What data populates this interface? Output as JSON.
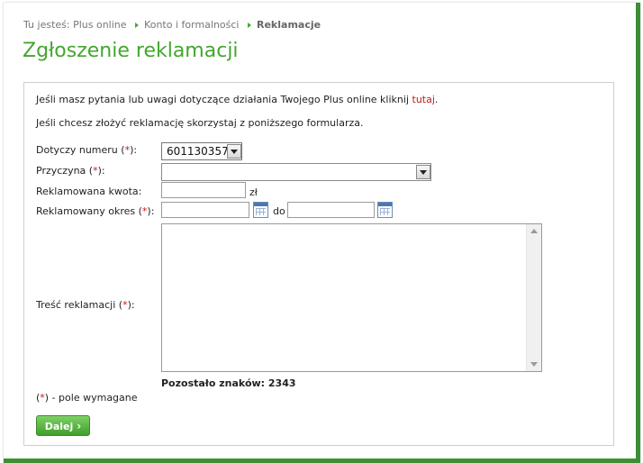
{
  "breadcrumb": {
    "prefix": "Tu jesteś:",
    "items": [
      "Plus online",
      "Konto i formalności",
      "Reklamacje"
    ]
  },
  "page_title": "Zgłoszenie reklamacji",
  "info": {
    "line1_text": "Jeśli masz pytania lub uwagi dotyczące działania Twojego Plus online kliknij ",
    "line1_link": "tutaj",
    "line1_end": ".",
    "line2": "Jeśli chcesz złożyć reklamację skorzystaj z poniższego formularza."
  },
  "form": {
    "number_label": "Dotyczy numeru",
    "number_value": "601130357",
    "reason_label": "Przyczyna",
    "reason_value": "",
    "amount_label": "Reklamowana kwota:",
    "amount_value": "",
    "currency": "zł",
    "period_label": "Reklamowany okres",
    "period_from": "",
    "period_to_label": "do",
    "period_to": "",
    "content_label": "Treść reklamacji",
    "content_value": "",
    "required_mark": "*",
    "counter_text": "Pozostało znaków: 2343",
    "required_note": "- pole wymagane"
  },
  "buttons": {
    "next_label": "Dalej"
  },
  "colors": {
    "accent": "#43a72f",
    "required": "#c31919",
    "frame": "#3d8f33"
  }
}
